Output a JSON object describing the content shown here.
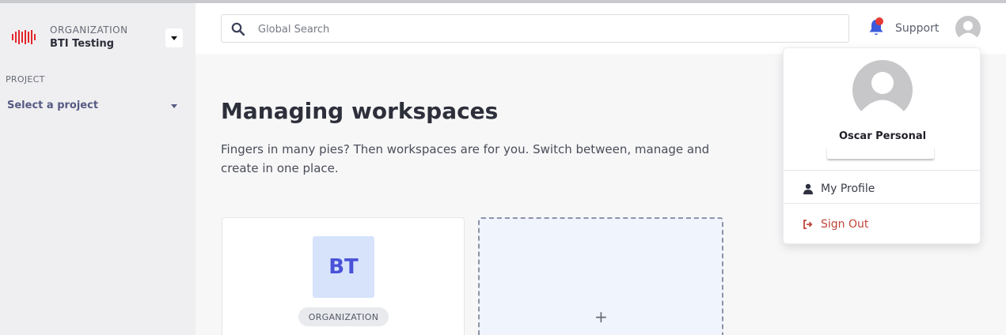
{
  "sidebar": {
    "org_kicker": "ORGANIZATION",
    "org_name": "BTI Testing",
    "project_label": "PROJECT",
    "project_select": "Select a project"
  },
  "header": {
    "search_placeholder": "Global Search",
    "support_label": "Support",
    "has_notification": true
  },
  "main": {
    "title": "Managing workspaces",
    "description": "Fingers in many pies? Then workspaces are for you. Switch between, manage and create in one place.",
    "cards": {
      "org_initials": "BT",
      "org_type": "ORGANIZATION",
      "add_symbol": "+"
    }
  },
  "user_menu": {
    "name": "Oscar Personal",
    "items": {
      "profile": "My Profile",
      "signout": "Sign Out"
    }
  },
  "colors": {
    "brand_red": "#e53935",
    "accent_blue": "#4a52d8",
    "danger": "#c0463a",
    "sidebar_bg": "#efeff1"
  }
}
